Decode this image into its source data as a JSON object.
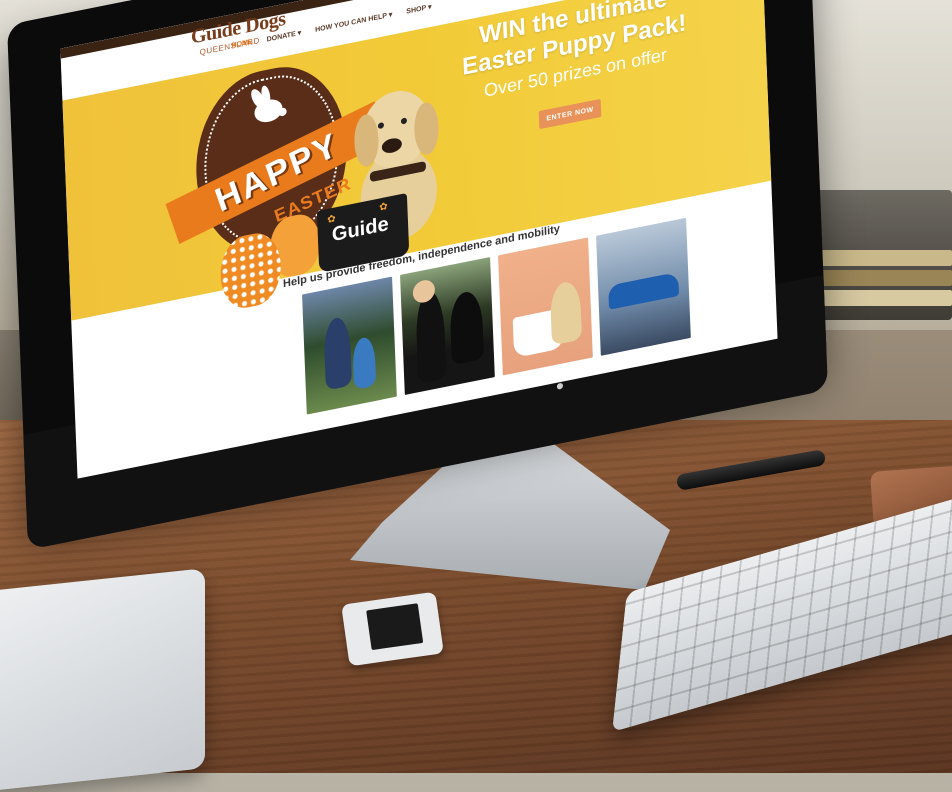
{
  "site": {
    "logo": {
      "name": "Guide Dogs",
      "subtitle": "QUEENSLAND"
    },
    "nav": [
      {
        "label": "HOME",
        "active": true,
        "has_dropdown": false
      },
      {
        "label": "DONATE",
        "active": false,
        "has_dropdown": true
      },
      {
        "label": "HOW YOU CAN HELP",
        "active": false,
        "has_dropdown": true
      },
      {
        "label": "SHOP",
        "active": false,
        "has_dropdown": true
      }
    ],
    "hero": {
      "title": "WIN the ultimate Easter Puppy Pack!",
      "subtitle": "Over 50 prizes on offer",
      "button": "ENTER NOW",
      "graphic": {
        "happy": "HAPPY",
        "easter": "EASTER",
        "pot_label": "Guide"
      }
    },
    "tagline": "Help us provide freedom, independence and mobility",
    "photos": [
      {
        "icon": "family-photo"
      },
      {
        "icon": "woman-with-guide-dog-photo"
      },
      {
        "icon": "merchandise-photo"
      },
      {
        "icon": "car-photo"
      }
    ]
  },
  "colors": {
    "brand_brown": "#7a3d1c",
    "accent_orange": "#e07a1e",
    "hero_yellow": "#f0c23a",
    "button": "#e8925a"
  }
}
